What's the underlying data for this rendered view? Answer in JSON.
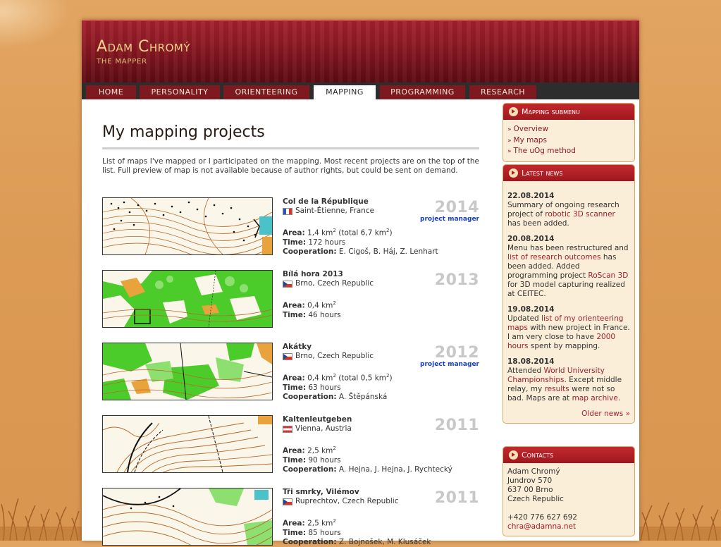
{
  "site": {
    "name": "Adam Chromý",
    "tagline": "THE MAPPER"
  },
  "nav": [
    {
      "label": "HOME",
      "active": false
    },
    {
      "label": "PERSONALITY",
      "active": false
    },
    {
      "label": "ORIENTEERING",
      "active": false
    },
    {
      "label": "MAPPING",
      "active": true
    },
    {
      "label": "PROGRAMMING",
      "active": false
    },
    {
      "label": "RESEARCH",
      "active": false
    }
  ],
  "main": {
    "title": "My mapping projects",
    "intro": "List of maps I've mapped or I participated on the mapping. Most recent projects are on the top of the list. Full preview of map is not available because of author rights, but could be sent on demand.",
    "labels": {
      "area": "Area:",
      "time": "Time:",
      "cooperation": "Cooperation:"
    },
    "projects": [
      {
        "name": "Col de la République",
        "location": "Saint-Étienne, France",
        "flag": "fr",
        "year": "2014",
        "role": "project manager",
        "area": "1,4 km",
        "area_extra": " (total 6,7 km",
        "time": "172 hours",
        "cooperation": "E. Cigoš, B. Háj, Z. Lenhart"
      },
      {
        "name": "Bílá hora 2013",
        "location": "Brno, Czech Republic",
        "flag": "cz",
        "year": "2013",
        "role": "",
        "area": "0,4 km",
        "area_extra": "",
        "time": "46 hours",
        "cooperation": ""
      },
      {
        "name": "Akátky",
        "location": "Brno, Czech Republic",
        "flag": "cz",
        "year": "2012",
        "role": "project manager",
        "area": "0,4 km",
        "area_extra": " (total 0,5 km",
        "time": "63 hours",
        "cooperation": "A. Štěpánská"
      },
      {
        "name": "Kaltenleutgeben",
        "location": "Vienna, Austria",
        "flag": "at",
        "year": "2011",
        "role": "",
        "area": "2,5 km",
        "area_extra": "",
        "time": "90 hours",
        "cooperation": "A. Hejna, J. Hejna, J. Rychtecký"
      },
      {
        "name": "Tři smrky, Vilémov",
        "location": "Ruprechtov, Czech Republic",
        "flag": "cz",
        "year": "2011",
        "role": "",
        "area": "2,5 km",
        "area_extra": "",
        "time": "85 hours",
        "cooperation": "Z. Bojnošek, M. Klusáček"
      }
    ]
  },
  "sidebar": {
    "submenu": {
      "title": "Mapping submenu",
      "links": [
        "Overview",
        "My maps",
        "The uOg method"
      ]
    },
    "news": {
      "title": "Latest news",
      "items": [
        {
          "date": "22.08.2014",
          "parts": [
            [
              "Summary of ongoing research project of ",
              false
            ],
            [
              "robotic 3D scanner",
              true
            ],
            [
              " has been added.",
              false
            ]
          ]
        },
        {
          "date": "20.08.2014",
          "parts": [
            [
              "Menu has been restructured and ",
              false
            ],
            [
              "list of research outcomes",
              true
            ],
            [
              " has been added. Added programming project ",
              false
            ],
            [
              "RoScan 3D",
              true
            ],
            [
              " for 3D model capturing realized at CEITEC.",
              false
            ]
          ]
        },
        {
          "date": "19.08.2014",
          "parts": [
            [
              "Updated ",
              false
            ],
            [
              "list of my orienteering maps",
              true
            ],
            [
              " with new project in France. I am very close to have ",
              false
            ],
            [
              "2000 hours",
              true
            ],
            [
              " spent by mapping.",
              false
            ]
          ]
        },
        {
          "date": "18.08.2014",
          "parts": [
            [
              "Attended ",
              false
            ],
            [
              "World University Championships",
              true
            ],
            [
              ". Except middle relay, my ",
              false
            ],
            [
              "results",
              true
            ],
            [
              " were not so bad. Maps are at ",
              false
            ],
            [
              "map archive",
              true
            ],
            [
              ".",
              false
            ]
          ]
        }
      ],
      "older": "Older news »"
    },
    "contacts": {
      "title": "Contacts",
      "lines": [
        "Adam Chromý",
        "Jundrov 570",
        "637 00 Brno",
        "Czech Republic"
      ],
      "phone": "+420 776 627 692",
      "email": "chra@adamna.net"
    }
  },
  "colors": {
    "accent": "#8e1a24",
    "year_gray": "#c8c8c8",
    "role_blue": "#1640c0"
  }
}
